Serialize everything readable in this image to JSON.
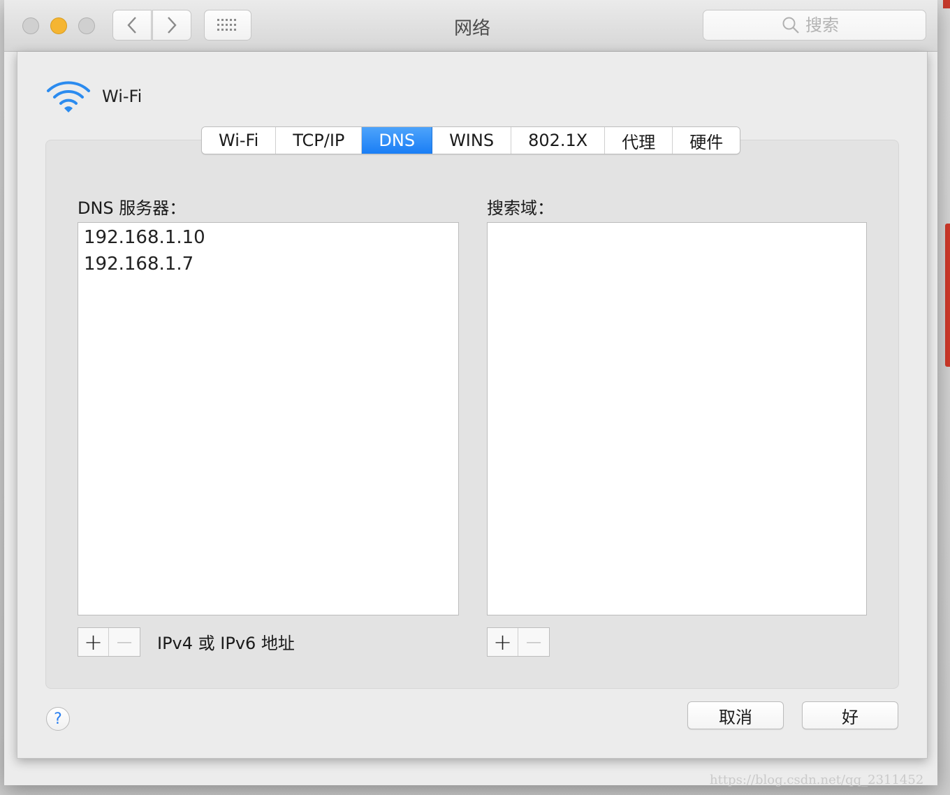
{
  "window": {
    "title": "网络",
    "search_placeholder": "搜索"
  },
  "interface": {
    "name": "Wi-Fi"
  },
  "tabs": [
    {
      "label": "Wi-Fi",
      "active": false
    },
    {
      "label": "TCP/IP",
      "active": false
    },
    {
      "label": "DNS",
      "active": true
    },
    {
      "label": "WINS",
      "active": false
    },
    {
      "label": "802.1X",
      "active": false
    },
    {
      "label": "代理",
      "active": false
    },
    {
      "label": "硬件",
      "active": false
    }
  ],
  "dns": {
    "servers_label": "DNS 服务器：",
    "servers": [
      "192.168.1.10",
      "192.168.1.7"
    ],
    "search_domains_label": "搜索域：",
    "search_domains": [],
    "add_label": "+",
    "remove_label": "−",
    "hint": "IPv4 或 IPv6 地址"
  },
  "buttons": {
    "help": "?",
    "cancel": "取消",
    "ok": "好"
  },
  "watermark": "https://blog.csdn.net/qq_2311452",
  "colors": {
    "accent": "#1a7ef5",
    "minimize": "#f5b532"
  }
}
